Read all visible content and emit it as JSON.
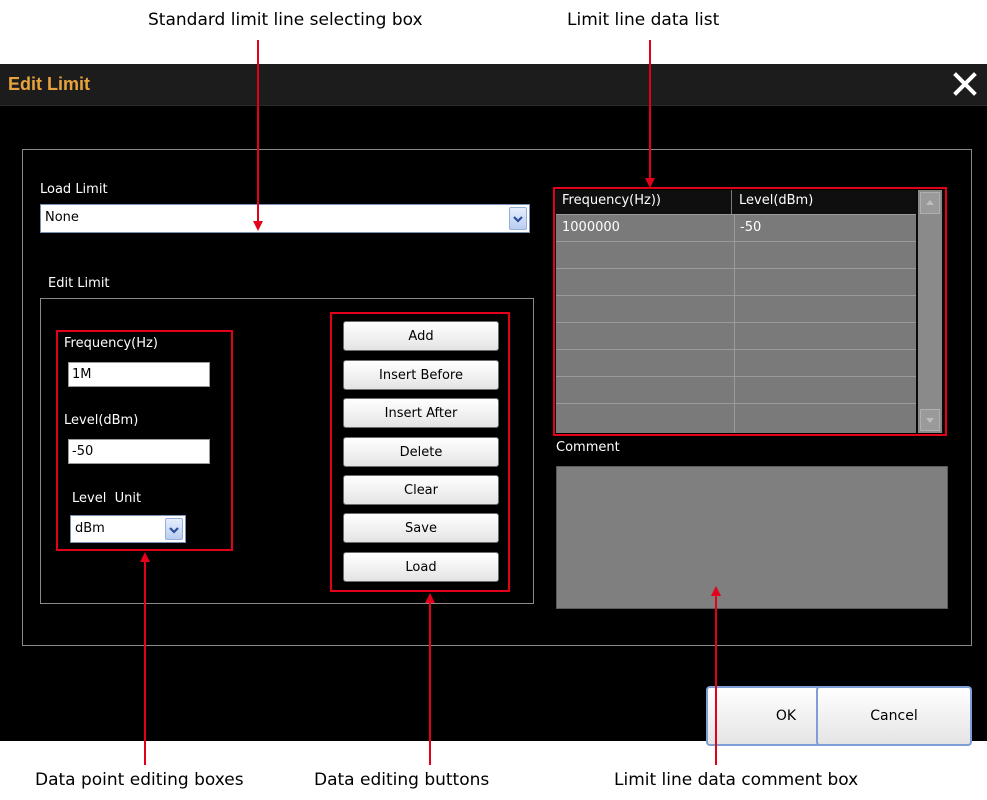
{
  "callouts": {
    "top_left": "Standard limit line selecting box",
    "top_right": "Limit line data list",
    "bottom_left": "Data point editing boxes",
    "bottom_mid": "Data editing buttons",
    "bottom_right": "Limit line data comment box"
  },
  "dialog": {
    "title": "Edit Limit",
    "load_limit": {
      "label": "Load Limit",
      "value": "None"
    },
    "edit_limit": {
      "label": "Edit Limit",
      "frequency": {
        "label": "Frequency(Hz)",
        "value": "1M"
      },
      "level": {
        "label": "Level(dBm)",
        "value": "-50"
      },
      "level_unit": {
        "label": "Level  Unit",
        "value": "dBm"
      }
    },
    "buttons": [
      "Add",
      "Insert Before",
      "Insert After",
      "Delete",
      "Clear",
      "Save",
      "Load"
    ],
    "table": {
      "columns": [
        "Frequency(Hz))",
        "Level(dBm)"
      ],
      "rows": [
        [
          "1000000",
          "-50"
        ],
        [
          "",
          ""
        ],
        [
          "",
          ""
        ],
        [
          "",
          ""
        ],
        [
          "",
          ""
        ],
        [
          "",
          ""
        ],
        [
          "",
          ""
        ],
        [
          "",
          ""
        ]
      ]
    },
    "comment": {
      "label": "Comment",
      "value": ""
    },
    "ok_label": "OK",
    "cancel_label": "Cancel"
  },
  "colors": {
    "title": "#e8a33d",
    "annotation": "#e2001a",
    "table_row_bg": "#7a7a7a",
    "comment_bg": "#7f7f7f"
  },
  "icons": [
    "close-icon",
    "chevron-down-icon",
    "scroll-up-icon",
    "scroll-down-icon"
  ]
}
